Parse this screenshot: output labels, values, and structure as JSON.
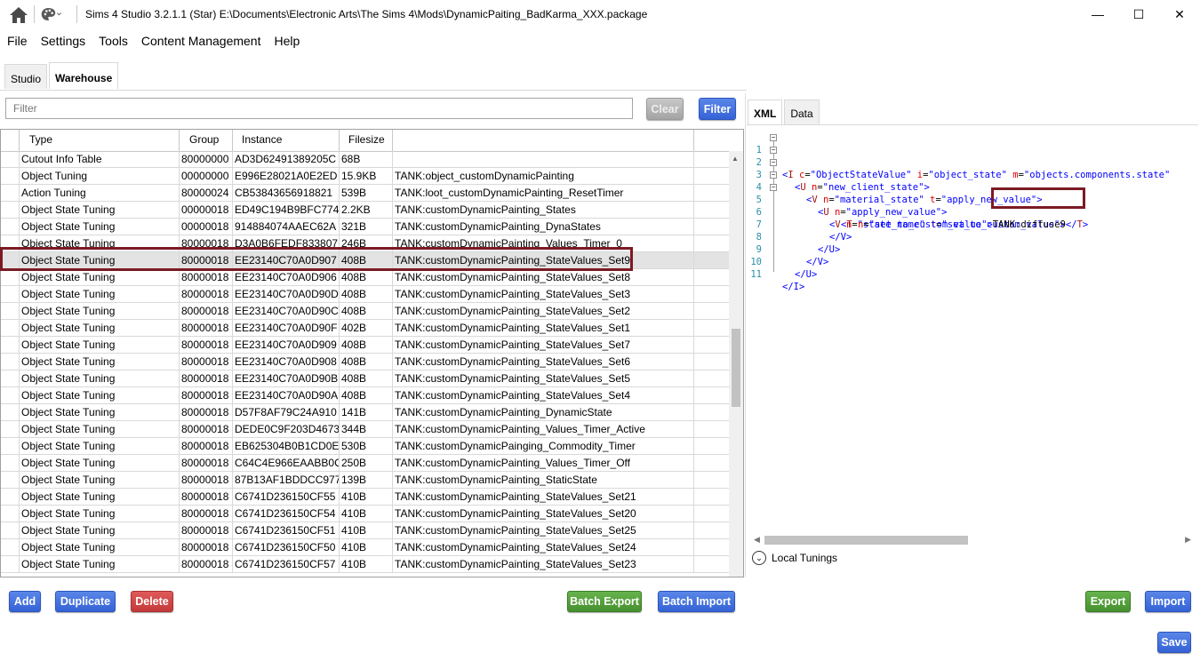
{
  "window": {
    "title": "Sims 4 Studio 3.2.1.1 (Star)  E:\\Documents\\Electronic Arts\\The Sims 4\\Mods\\DynamicPaiting_BadKarma_XXX.package",
    "minimize": "—",
    "maximize": "☐",
    "close": "✕"
  },
  "menu": [
    "File",
    "Settings",
    "Tools",
    "Content Management",
    "Help"
  ],
  "tabs": [
    "Studio",
    "Warehouse"
  ],
  "filter": {
    "placeholder": "Filter",
    "clear_label": "Clear",
    "filter_label": "Filter"
  },
  "table": {
    "headers": [
      "",
      "Type",
      "Group",
      "Instance",
      "Filesize",
      "",
      ""
    ],
    "rows": [
      [
        "",
        "Cutout Info Table",
        "80000000",
        "AD3D62491389205C",
        "68B",
        ""
      ],
      [
        "",
        "Object Tuning",
        "00000000",
        "E996E28021A0E2ED",
        "15.9KB",
        "TANK:object_customDynamicPainting"
      ],
      [
        "",
        "Action Tuning",
        "80000024",
        "CB53843656918821",
        "539B",
        "TANK:loot_customDynamicPainting_ResetTimer"
      ],
      [
        "",
        "Object State Tuning",
        "00000018",
        "ED49C194B9BFC774",
        "2.2KB",
        "TANK:customDynamicPainting_States"
      ],
      [
        "",
        "Object State Tuning",
        "00000018",
        "914884074AAEC62A",
        "321B",
        "TANK:customDynamicPainting_DynaStates"
      ],
      [
        "",
        "Object State Tuning",
        "80000018",
        "D3A0B6FEDF833807",
        "246B",
        "TANK:customDynamicPainting_Values_Timer_0"
      ],
      [
        "",
        "Object State Tuning",
        "80000018",
        "EE23140C70A0D907",
        "408B",
        "TANK:customDynamicPainting_StateValues_Set9"
      ],
      [
        "",
        "Object State Tuning",
        "80000018",
        "EE23140C70A0D906",
        "408B",
        "TANK:customDynamicPainting_StateValues_Set8"
      ],
      [
        "",
        "Object State Tuning",
        "80000018",
        "EE23140C70A0D90D",
        "408B",
        "TANK:customDynamicPainting_StateValues_Set3"
      ],
      [
        "",
        "Object State Tuning",
        "80000018",
        "EE23140C70A0D90C",
        "408B",
        "TANK:customDynamicPainting_StateValues_Set2"
      ],
      [
        "",
        "Object State Tuning",
        "80000018",
        "EE23140C70A0D90F",
        "402B",
        "TANK:customDynamicPainting_StateValues_Set1"
      ],
      [
        "",
        "Object State Tuning",
        "80000018",
        "EE23140C70A0D909",
        "408B",
        "TANK:customDynamicPainting_StateValues_Set7"
      ],
      [
        "",
        "Object State Tuning",
        "80000018",
        "EE23140C70A0D908",
        "408B",
        "TANK:customDynamicPainting_StateValues_Set6"
      ],
      [
        "",
        "Object State Tuning",
        "80000018",
        "EE23140C70A0D90B",
        "408B",
        "TANK:customDynamicPainting_StateValues_Set5"
      ],
      [
        "",
        "Object State Tuning",
        "80000018",
        "EE23140C70A0D90A",
        "408B",
        "TANK:customDynamicPainting_StateValues_Set4"
      ],
      [
        "",
        "Object State Tuning",
        "80000018",
        "D57F8AF79C24A910",
        "141B",
        "TANK:customDynamicPainting_DynamicState"
      ],
      [
        "",
        "Object State Tuning",
        "80000018",
        "DEDE0C9F203D4673",
        "344B",
        "TANK:customDynamicPainting_Values_Timer_Active"
      ],
      [
        "",
        "Object State Tuning",
        "80000018",
        "EB625304B0B1CD0E",
        "530B",
        "TANK:customDynamicPainging_Commodity_Timer"
      ],
      [
        "",
        "Object State Tuning",
        "80000018",
        "C64C4E966EAABB0C",
        "250B",
        "TANK:customDynamicPainting_Values_Timer_Off"
      ],
      [
        "",
        "Object State Tuning",
        "80000018",
        "87B13AF1BDDCC977",
        "139B",
        "TANK:customDynamicPainting_StaticState"
      ],
      [
        "",
        "Object State Tuning",
        "80000018",
        "C6741D236150CF55",
        "410B",
        "TANK:customDynamicPainting_StateValues_Set21"
      ],
      [
        "",
        "Object State Tuning",
        "80000018",
        "C6741D236150CF54",
        "410B",
        "TANK:customDynamicPainting_StateValues_Set20"
      ],
      [
        "",
        "Object State Tuning",
        "80000018",
        "C6741D236150CF51",
        "410B",
        "TANK:customDynamicPainting_StateValues_Set25"
      ],
      [
        "",
        "Object State Tuning",
        "80000018",
        "C6741D236150CF50",
        "410B",
        "TANK:customDynamicPainting_StateValues_Set24"
      ],
      [
        "",
        "Object State Tuning",
        "80000018",
        "C6741D236150CF57",
        "410B",
        "TANK:customDynamicPainting_StateValues_Set23"
      ]
    ],
    "selected_row": 6
  },
  "xml_tabs": [
    "XML",
    "Data"
  ],
  "xml": {
    "line_numbers": [
      "1",
      "2",
      "3",
      "4",
      "5",
      "6",
      "7",
      "8",
      "9",
      "10",
      "11"
    ],
    "l1": {
      "tag": "I",
      "a1": "c",
      "v1": "\"ObjectStateValue\"",
      "a2": "i",
      "v2": "\"object_state\"",
      "a3": "m",
      "v3": "\"objects.components.state\""
    },
    "l2": {
      "tag": "U",
      "a1": "n",
      "v1": "\"new_client_state\""
    },
    "l3": {
      "tag": "V",
      "a1": "n",
      "v1": "\"material_state\"",
      "a2": "t",
      "v2": "\"apply_new_value\""
    },
    "l4": {
      "tag": "U",
      "a1": "n",
      "v1": "\"apply_new_value\""
    },
    "l5": {
      "tag": "V",
      "a1": "n",
      "v1": "\"state_name\"",
      "a2": "t",
      "v2": "\"set_to_custom_value\""
    },
    "l6": {
      "tag": "T",
      "a1": "n",
      "v1": "\"set_to_custom_value\"",
      "text": "TANK:diffuse9"
    },
    "closes": [
      "</V>",
      "</U>",
      "</V>",
      "</U>",
      "</I>"
    ]
  },
  "local_tunings": "Local Tunings",
  "buttons": {
    "add": "Add",
    "duplicate": "Duplicate",
    "delete": "Delete",
    "batch_export": "Batch Export",
    "batch_import": "Batch Import",
    "export": "Export",
    "import": "Import",
    "save": "Save"
  },
  "colors": {
    "accent_blue": "#3d6ddb",
    "green": "#4f9a36",
    "red": "#cf4545",
    "highlight": "#7b1a23"
  }
}
